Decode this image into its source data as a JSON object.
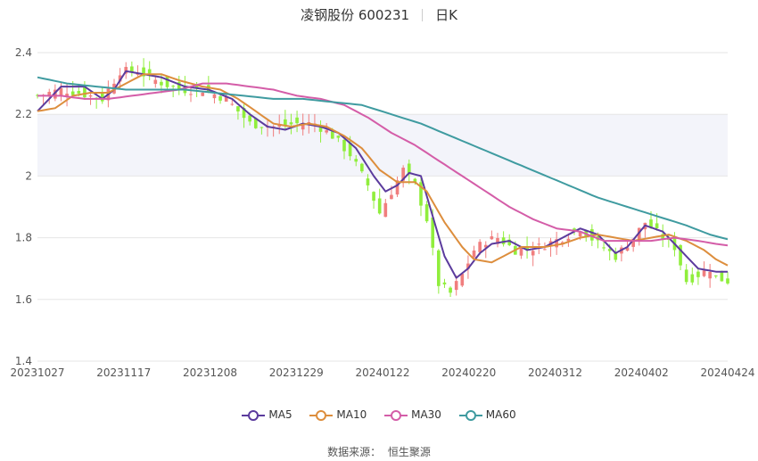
{
  "header": {
    "title": "凌钢股份 600231",
    "period": "日K"
  },
  "source": {
    "label": "数据来源：",
    "value": "恒生聚源"
  },
  "chart_data": {
    "type": "candlestick",
    "ylim": [
      1.4,
      2.4
    ],
    "yticks": [
      "1.4",
      "1.6",
      "1.8",
      "2",
      "2.2",
      "2.4"
    ],
    "xticks": [
      "20231027",
      "20231117",
      "20231208",
      "20231229",
      "20240122",
      "20240220",
      "20240312",
      "20240402",
      "20240424"
    ],
    "colors": {
      "up": "#f07e7e",
      "down": "#90ee3c",
      "band": "#f3f4fa",
      "grid": "#e6e6e6"
    },
    "legend": [
      {
        "name": "MA5",
        "color": "#5b3b9d"
      },
      {
        "name": "MA10",
        "color": "#dd8e3d"
      },
      {
        "name": "MA30",
        "color": "#d45da8"
      },
      {
        "name": "MA60",
        "color": "#3f9ba0"
      }
    ],
    "close_anchors": [
      [
        0,
        2.26
      ],
      [
        4,
        2.28
      ],
      [
        7,
        2.27
      ],
      [
        11,
        2.25
      ],
      [
        14,
        2.34
      ],
      [
        17,
        2.34
      ],
      [
        20,
        2.31
      ],
      [
        24,
        2.28
      ],
      [
        28,
        2.28
      ],
      [
        32,
        2.25
      ],
      [
        36,
        2.17
      ],
      [
        40,
        2.16
      ],
      [
        44,
        2.17
      ],
      [
        47,
        2.17
      ],
      [
        50,
        2.13
      ],
      [
        53,
        2.07
      ],
      [
        56,
        1.97
      ],
      [
        58,
        1.88
      ],
      [
        60,
        1.95
      ],
      [
        62,
        2.02
      ],
      [
        64,
        1.97
      ],
      [
        66,
        1.86
      ],
      [
        68,
        1.65
      ],
      [
        70,
        1.62
      ],
      [
        72,
        1.68
      ],
      [
        74,
        1.76
      ],
      [
        76,
        1.79
      ],
      [
        78,
        1.8
      ],
      [
        81,
        1.76
      ],
      [
        85,
        1.77
      ],
      [
        89,
        1.8
      ],
      [
        92,
        1.83
      ],
      [
        95,
        1.78
      ],
      [
        98,
        1.74
      ],
      [
        101,
        1.8
      ],
      [
        103,
        1.85
      ],
      [
        106,
        1.8
      ],
      [
        108,
        1.77
      ],
      [
        110,
        1.66
      ],
      [
        112,
        1.68
      ],
      [
        114,
        1.7
      ],
      [
        115,
        1.67
      ],
      [
        117,
        1.66
      ]
    ],
    "ma_anchors": {
      "MA5": [
        [
          0,
          2.21
        ],
        [
          4,
          2.29
        ],
        [
          8,
          2.29
        ],
        [
          11,
          2.25
        ],
        [
          13,
          2.28
        ],
        [
          15,
          2.34
        ],
        [
          18,
          2.33
        ],
        [
          21,
          2.32
        ],
        [
          25,
          2.29
        ],
        [
          29,
          2.28
        ],
        [
          33,
          2.25
        ],
        [
          36,
          2.2
        ],
        [
          39,
          2.16
        ],
        [
          42,
          2.15
        ],
        [
          45,
          2.17
        ],
        [
          48,
          2.16
        ],
        [
          51,
          2.14
        ],
        [
          54,
          2.09
        ],
        [
          57,
          2.0
        ],
        [
          59,
          1.95
        ],
        [
          61,
          1.97
        ],
        [
          63,
          2.01
        ],
        [
          65,
          2.0
        ],
        [
          67,
          1.87
        ],
        [
          69,
          1.74
        ],
        [
          71,
          1.67
        ],
        [
          73,
          1.7
        ],
        [
          75,
          1.75
        ],
        [
          77,
          1.78
        ],
        [
          80,
          1.79
        ],
        [
          83,
          1.76
        ],
        [
          86,
          1.77
        ],
        [
          89,
          1.8
        ],
        [
          92,
          1.83
        ],
        [
          95,
          1.81
        ],
        [
          98,
          1.75
        ],
        [
          100,
          1.77
        ],
        [
          103,
          1.84
        ],
        [
          106,
          1.82
        ],
        [
          109,
          1.76
        ],
        [
          112,
          1.7
        ],
        [
          115,
          1.69
        ],
        [
          117,
          1.69
        ]
      ],
      "MA10": [
        [
          0,
          2.21
        ],
        [
          3,
          2.22
        ],
        [
          6,
          2.26
        ],
        [
          9,
          2.27
        ],
        [
          12,
          2.27
        ],
        [
          15,
          2.3
        ],
        [
          18,
          2.33
        ],
        [
          21,
          2.33
        ],
        [
          24,
          2.31
        ],
        [
          28,
          2.29
        ],
        [
          31,
          2.28
        ],
        [
          34,
          2.25
        ],
        [
          37,
          2.21
        ],
        [
          40,
          2.17
        ],
        [
          43,
          2.16
        ],
        [
          46,
          2.17
        ],
        [
          49,
          2.16
        ],
        [
          52,
          2.13
        ],
        [
          55,
          2.09
        ],
        [
          58,
          2.02
        ],
        [
          61,
          1.98
        ],
        [
          64,
          1.98
        ],
        [
          66,
          1.95
        ],
        [
          69,
          1.85
        ],
        [
          72,
          1.77
        ],
        [
          74,
          1.73
        ],
        [
          77,
          1.72
        ],
        [
          79,
          1.74
        ],
        [
          82,
          1.77
        ],
        [
          86,
          1.77
        ],
        [
          89,
          1.78
        ],
        [
          92,
          1.8
        ],
        [
          95,
          1.81
        ],
        [
          98,
          1.8
        ],
        [
          101,
          1.79
        ],
        [
          104,
          1.8
        ],
        [
          107,
          1.81
        ],
        [
          110,
          1.79
        ],
        [
          113,
          1.76
        ],
        [
          115,
          1.73
        ],
        [
          117,
          1.71
        ]
      ],
      "MA30": [
        [
          0,
          2.26
        ],
        [
          4,
          2.26
        ],
        [
          8,
          2.25
        ],
        [
          12,
          2.25
        ],
        [
          16,
          2.26
        ],
        [
          20,
          2.27
        ],
        [
          24,
          2.28
        ],
        [
          28,
          2.3
        ],
        [
          32,
          2.3
        ],
        [
          36,
          2.29
        ],
        [
          40,
          2.28
        ],
        [
          44,
          2.26
        ],
        [
          48,
          2.25
        ],
        [
          52,
          2.23
        ],
        [
          56,
          2.19
        ],
        [
          60,
          2.14
        ],
        [
          64,
          2.1
        ],
        [
          68,
          2.05
        ],
        [
          72,
          2.0
        ],
        [
          76,
          1.95
        ],
        [
          80,
          1.9
        ],
        [
          84,
          1.86
        ],
        [
          88,
          1.83
        ],
        [
          92,
          1.82
        ],
        [
          96,
          1.79
        ],
        [
          100,
          1.79
        ],
        [
          104,
          1.79
        ],
        [
          108,
          1.8
        ],
        [
          112,
          1.79
        ],
        [
          115,
          1.78
        ],
        [
          117,
          1.775
        ]
      ],
      "MA60": [
        [
          0,
          2.32
        ],
        [
          5,
          2.3
        ],
        [
          10,
          2.29
        ],
        [
          15,
          2.28
        ],
        [
          20,
          2.28
        ],
        [
          25,
          2.28
        ],
        [
          30,
          2.27
        ],
        [
          35,
          2.26
        ],
        [
          40,
          2.25
        ],
        [
          45,
          2.25
        ],
        [
          50,
          2.24
        ],
        [
          55,
          2.23
        ],
        [
          60,
          2.2
        ],
        [
          65,
          2.17
        ],
        [
          70,
          2.13
        ],
        [
          75,
          2.09
        ],
        [
          80,
          2.05
        ],
        [
          85,
          2.01
        ],
        [
          90,
          1.97
        ],
        [
          95,
          1.93
        ],
        [
          100,
          1.9
        ],
        [
          105,
          1.87
        ],
        [
          110,
          1.84
        ],
        [
          114,
          1.81
        ],
        [
          117,
          1.795
        ]
      ]
    },
    "count": 118
  }
}
